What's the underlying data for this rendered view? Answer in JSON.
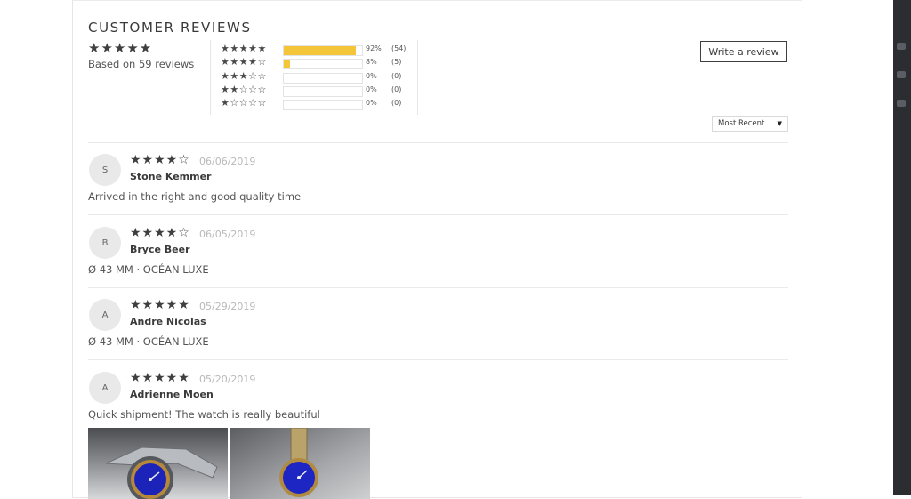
{
  "section_title": "CUSTOMER REVIEWS",
  "summary": {
    "stars": "★★★★★",
    "based_on": "Based on 59 reviews"
  },
  "histogram": [
    {
      "stars": "★★★★★",
      "fill": 0.92,
      "percent": "92%",
      "count": "(54)"
    },
    {
      "stars": "★★★★☆",
      "fill": 0.08,
      "percent": "8%",
      "count": "(5)"
    },
    {
      "stars": "★★★☆☆",
      "fill": 0,
      "percent": "0%",
      "count": "(0)"
    },
    {
      "stars": "★★☆☆☆",
      "fill": 0,
      "percent": "0%",
      "count": "(0)"
    },
    {
      "stars": "★☆☆☆☆",
      "fill": 0,
      "percent": "0%",
      "count": "(0)"
    }
  ],
  "write_review_label": "Write a review",
  "sort": {
    "selected": "Most Recent",
    "arrow": "▼"
  },
  "reviews": [
    {
      "initial": "S",
      "stars": "★★★★☆",
      "date": "06/06/2019",
      "name": "Stone Kemmer",
      "body": "Arrived in the right and good quality time"
    },
    {
      "initial": "B",
      "stars": "★★★★☆",
      "date": "06/05/2019",
      "name": "Bryce Beer",
      "body": "Ø 43 MM · OCÉAN LUXE"
    },
    {
      "initial": "A",
      "stars": "★★★★★",
      "date": "05/29/2019",
      "name": "Andre Nicolas",
      "body": "Ø 43 MM · OCÉAN LUXE"
    },
    {
      "initial": "A",
      "stars": "★★★★★",
      "date": "05/20/2019",
      "name": "Adrienne Moen",
      "body": "Quick shipment! The watch is really beautiful"
    }
  ],
  "colors": {
    "star": "#3f3f3f",
    "bar_fill": "#f3c63a",
    "date": "#b9b9b9",
    "avatar_bg": "#e9e9e9"
  }
}
